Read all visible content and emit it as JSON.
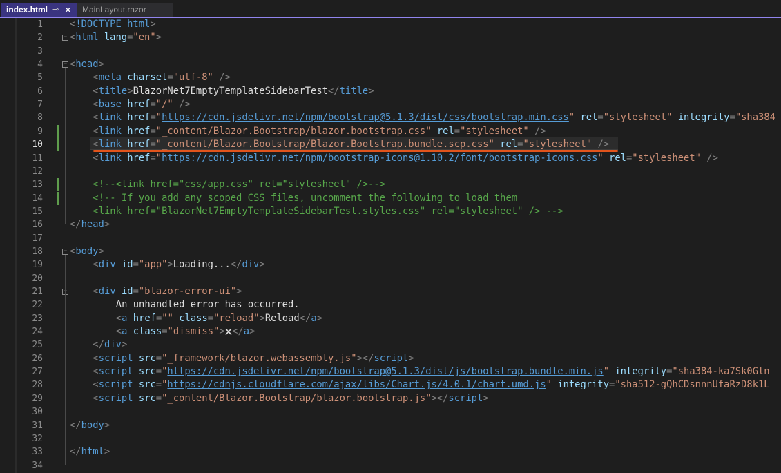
{
  "tabs": [
    {
      "label": "index.html",
      "active": true
    },
    {
      "label": "MainLayout.razor",
      "active": false
    }
  ],
  "editor": {
    "current_line": 10,
    "changed_lines": [
      9,
      10,
      13,
      14
    ],
    "line_numbers": [
      "1",
      "2",
      "3",
      "4",
      "5",
      "6",
      "7",
      "8",
      "9",
      "10",
      "11",
      "12",
      "13",
      "14",
      "15",
      "16",
      "17",
      "18",
      "19",
      "20",
      "21",
      "22",
      "23",
      "24",
      "25",
      "26",
      "27",
      "28",
      "29",
      "30",
      "31",
      "32",
      "33",
      "34"
    ],
    "lines": [
      {
        "n": 1,
        "indent": 0,
        "tokens": [
          [
            "d",
            "<"
          ],
          [
            "t",
            "!DOCTYPE"
          ],
          [
            "tx",
            " "
          ],
          [
            "t",
            "html"
          ],
          [
            "d",
            ">"
          ]
        ]
      },
      {
        "n": 2,
        "indent": 0,
        "tokens": [
          [
            "d",
            "<"
          ],
          [
            "t",
            "html"
          ],
          [
            "tx",
            " "
          ],
          [
            "a",
            "lang"
          ],
          [
            "d",
            "="
          ],
          [
            "v",
            "\"en\""
          ],
          [
            "d",
            ">"
          ]
        ]
      },
      {
        "n": 3,
        "indent": 0,
        "tokens": []
      },
      {
        "n": 4,
        "indent": 0,
        "tokens": [
          [
            "d",
            "<"
          ],
          [
            "t",
            "head"
          ],
          [
            "d",
            ">"
          ]
        ]
      },
      {
        "n": 5,
        "indent": 1,
        "tokens": [
          [
            "d",
            "<"
          ],
          [
            "t",
            "meta"
          ],
          [
            "tx",
            " "
          ],
          [
            "a",
            "charset"
          ],
          [
            "d",
            "="
          ],
          [
            "v",
            "\"utf-8\""
          ],
          [
            "tx",
            " "
          ],
          [
            "d",
            "/>"
          ]
        ]
      },
      {
        "n": 6,
        "indent": 1,
        "tokens": [
          [
            "d",
            "<"
          ],
          [
            "t",
            "title"
          ],
          [
            "d",
            ">"
          ],
          [
            "tx",
            "BlazorNet7EmptyTemplateSidebarTest"
          ],
          [
            "d",
            "</"
          ],
          [
            "t",
            "title"
          ],
          [
            "d",
            ">"
          ]
        ]
      },
      {
        "n": 7,
        "indent": 1,
        "tokens": [
          [
            "d",
            "<"
          ],
          [
            "t",
            "base"
          ],
          [
            "tx",
            " "
          ],
          [
            "a",
            "href"
          ],
          [
            "d",
            "="
          ],
          [
            "v",
            "\"/\""
          ],
          [
            "tx",
            " "
          ],
          [
            "d",
            "/>"
          ]
        ]
      },
      {
        "n": 8,
        "indent": 1,
        "tokens": [
          [
            "d",
            "<"
          ],
          [
            "t",
            "link"
          ],
          [
            "tx",
            " "
          ],
          [
            "a",
            "href"
          ],
          [
            "d",
            "="
          ],
          [
            "v",
            "\""
          ],
          [
            "u",
            "https://cdn.jsdelivr.net/npm/bootstrap@5.1.3/dist/css/bootstrap.min.css"
          ],
          [
            "v",
            "\""
          ],
          [
            "tx",
            " "
          ],
          [
            "a",
            "rel"
          ],
          [
            "d",
            "="
          ],
          [
            "v",
            "\"stylesheet\""
          ],
          [
            "tx",
            " "
          ],
          [
            "a",
            "integrity"
          ],
          [
            "d",
            "="
          ],
          [
            "v",
            "\"sha384"
          ]
        ]
      },
      {
        "n": 9,
        "indent": 1,
        "tokens": [
          [
            "d",
            "<"
          ],
          [
            "t",
            "link"
          ],
          [
            "tx",
            " "
          ],
          [
            "a",
            "href"
          ],
          [
            "d",
            "="
          ],
          [
            "v",
            "\"_content/Blazor.Bootstrap/blazor.bootstrap.css\""
          ],
          [
            "tx",
            " "
          ],
          [
            "a",
            "rel"
          ],
          [
            "d",
            "="
          ],
          [
            "v",
            "\"stylesheet\""
          ],
          [
            "tx",
            " "
          ],
          [
            "d",
            "/>"
          ]
        ]
      },
      {
        "n": 10,
        "indent": 1,
        "tokens": [
          [
            "d",
            "<"
          ],
          [
            "t",
            "link"
          ],
          [
            "tx",
            " "
          ],
          [
            "a",
            "href"
          ],
          [
            "d",
            "="
          ],
          [
            "v",
            "\"_content/Blazor.Bootstrap/Blazor.Bootstrap.bundle.scp.css\""
          ],
          [
            "tx",
            " "
          ],
          [
            "a",
            "rel"
          ],
          [
            "d",
            "="
          ],
          [
            "v",
            "\"stylesheet\""
          ],
          [
            "tx",
            " "
          ],
          [
            "d",
            "/>"
          ]
        ]
      },
      {
        "n": 11,
        "indent": 1,
        "tokens": [
          [
            "d",
            "<"
          ],
          [
            "t",
            "link"
          ],
          [
            "tx",
            " "
          ],
          [
            "a",
            "href"
          ],
          [
            "d",
            "="
          ],
          [
            "v",
            "\""
          ],
          [
            "u",
            "https://cdn.jsdelivr.net/npm/bootstrap-icons@1.10.2/font/bootstrap-icons.css"
          ],
          [
            "v",
            "\""
          ],
          [
            "tx",
            " "
          ],
          [
            "a",
            "rel"
          ],
          [
            "d",
            "="
          ],
          [
            "v",
            "\"stylesheet\""
          ],
          [
            "tx",
            " "
          ],
          [
            "d",
            "/>"
          ]
        ]
      },
      {
        "n": 12,
        "indent": 0,
        "tokens": []
      },
      {
        "n": 13,
        "indent": 1,
        "tokens": [
          [
            "c",
            "<!--<link href=\"css/app.css\" rel=\"stylesheet\" />-->"
          ]
        ]
      },
      {
        "n": 14,
        "indent": 1,
        "tokens": [
          [
            "c",
            "<!-- If you add any scoped CSS files, uncomment the following to load them"
          ]
        ]
      },
      {
        "n": 15,
        "indent": 1,
        "tokens": [
          [
            "c",
            "<link href=\"BlazorNet7EmptyTemplateSidebarTest.styles.css\" rel=\"stylesheet\" /> -->"
          ]
        ]
      },
      {
        "n": 16,
        "indent": 0,
        "tokens": [
          [
            "d",
            "</"
          ],
          [
            "t",
            "head"
          ],
          [
            "d",
            ">"
          ]
        ]
      },
      {
        "n": 17,
        "indent": 0,
        "tokens": []
      },
      {
        "n": 18,
        "indent": 0,
        "tokens": [
          [
            "d",
            "<"
          ],
          [
            "t",
            "body"
          ],
          [
            "d",
            ">"
          ]
        ]
      },
      {
        "n": 19,
        "indent": 1,
        "tokens": [
          [
            "d",
            "<"
          ],
          [
            "t",
            "div"
          ],
          [
            "tx",
            " "
          ],
          [
            "a",
            "id"
          ],
          [
            "d",
            "="
          ],
          [
            "v",
            "\"app\""
          ],
          [
            "d",
            ">"
          ],
          [
            "tx",
            "Loading..."
          ],
          [
            "d",
            "</"
          ],
          [
            "t",
            "div"
          ],
          [
            "d",
            ">"
          ]
        ]
      },
      {
        "n": 20,
        "indent": 0,
        "tokens": []
      },
      {
        "n": 21,
        "indent": 1,
        "tokens": [
          [
            "d",
            "<"
          ],
          [
            "t",
            "div"
          ],
          [
            "tx",
            " "
          ],
          [
            "a",
            "id"
          ],
          [
            "d",
            "="
          ],
          [
            "v",
            "\"blazor-error-ui\""
          ],
          [
            "d",
            ">"
          ]
        ]
      },
      {
        "n": 22,
        "indent": 2,
        "tokens": [
          [
            "tx",
            "An unhandled error has occurred."
          ]
        ]
      },
      {
        "n": 23,
        "indent": 2,
        "tokens": [
          [
            "d",
            "<"
          ],
          [
            "t",
            "a"
          ],
          [
            "tx",
            " "
          ],
          [
            "a",
            "href"
          ],
          [
            "d",
            "="
          ],
          [
            "v",
            "\"\""
          ],
          [
            "tx",
            " "
          ],
          [
            "a",
            "class"
          ],
          [
            "d",
            "="
          ],
          [
            "v",
            "\"reload\""
          ],
          [
            "d",
            ">"
          ],
          [
            "tx",
            "Reload"
          ],
          [
            "d",
            "</"
          ],
          [
            "t",
            "a"
          ],
          [
            "d",
            ">"
          ]
        ]
      },
      {
        "n": 24,
        "indent": 2,
        "tokens": [
          [
            "d",
            "<"
          ],
          [
            "t",
            "a"
          ],
          [
            "tx",
            " "
          ],
          [
            "a",
            "class"
          ],
          [
            "d",
            "="
          ],
          [
            "v",
            "\"dismiss\""
          ],
          [
            "d",
            ">"
          ],
          [
            "tx",
            "🗙"
          ],
          [
            "d",
            "</"
          ],
          [
            "t",
            "a"
          ],
          [
            "d",
            ">"
          ]
        ]
      },
      {
        "n": 25,
        "indent": 1,
        "tokens": [
          [
            "d",
            "</"
          ],
          [
            "t",
            "div"
          ],
          [
            "d",
            ">"
          ]
        ]
      },
      {
        "n": 26,
        "indent": 1,
        "tokens": [
          [
            "d",
            "<"
          ],
          [
            "t",
            "script"
          ],
          [
            "tx",
            " "
          ],
          [
            "a",
            "src"
          ],
          [
            "d",
            "="
          ],
          [
            "v",
            "\"_framework/blazor.webassembly.js\""
          ],
          [
            "d",
            "></"
          ],
          [
            "t",
            "script"
          ],
          [
            "d",
            ">"
          ]
        ]
      },
      {
        "n": 27,
        "indent": 1,
        "tokens": [
          [
            "d",
            "<"
          ],
          [
            "t",
            "script"
          ],
          [
            "tx",
            " "
          ],
          [
            "a",
            "src"
          ],
          [
            "d",
            "="
          ],
          [
            "v",
            "\""
          ],
          [
            "u",
            "https://cdn.jsdelivr.net/npm/bootstrap@5.1.3/dist/js/bootstrap.bundle.min.js"
          ],
          [
            "v",
            "\""
          ],
          [
            "tx",
            " "
          ],
          [
            "a",
            "integrity"
          ],
          [
            "d",
            "="
          ],
          [
            "v",
            "\"sha384-ka7Sk0Gln"
          ]
        ]
      },
      {
        "n": 28,
        "indent": 1,
        "tokens": [
          [
            "d",
            "<"
          ],
          [
            "t",
            "script"
          ],
          [
            "tx",
            " "
          ],
          [
            "a",
            "src"
          ],
          [
            "d",
            "="
          ],
          [
            "v",
            "\""
          ],
          [
            "u",
            "https://cdnjs.cloudflare.com/ajax/libs/Chart.js/4.0.1/chart.umd.js"
          ],
          [
            "v",
            "\""
          ],
          [
            "tx",
            " "
          ],
          [
            "a",
            "integrity"
          ],
          [
            "d",
            "="
          ],
          [
            "v",
            "\"sha512-gQhCDsnnnUfaRzD8k1L"
          ]
        ]
      },
      {
        "n": 29,
        "indent": 1,
        "tokens": [
          [
            "d",
            "<"
          ],
          [
            "t",
            "script"
          ],
          [
            "tx",
            " "
          ],
          [
            "a",
            "src"
          ],
          [
            "d",
            "="
          ],
          [
            "v",
            "\"_content/Blazor.Bootstrap/blazor.bootstrap.js\""
          ],
          [
            "d",
            "></"
          ],
          [
            "t",
            "script"
          ],
          [
            "d",
            ">"
          ]
        ]
      },
      {
        "n": 30,
        "indent": 0,
        "tokens": []
      },
      {
        "n": 31,
        "indent": 0,
        "tokens": [
          [
            "d",
            "</"
          ],
          [
            "t",
            "body"
          ],
          [
            "d",
            ">"
          ]
        ]
      },
      {
        "n": 32,
        "indent": 0,
        "tokens": []
      },
      {
        "n": 33,
        "indent": 0,
        "tokens": [
          [
            "d",
            "</"
          ],
          [
            "t",
            "html"
          ],
          [
            "d",
            ">"
          ]
        ]
      },
      {
        "n": 34,
        "indent": 0,
        "tokens": []
      }
    ]
  }
}
